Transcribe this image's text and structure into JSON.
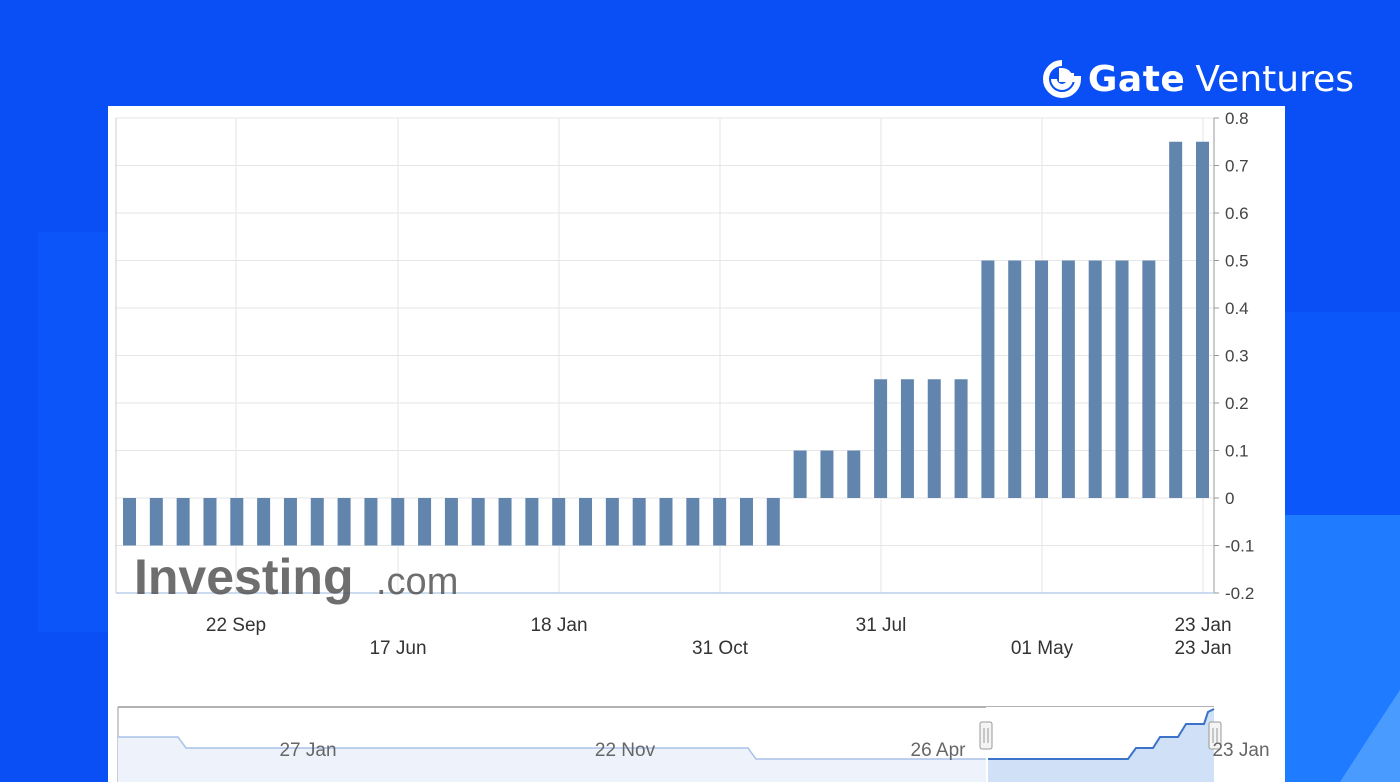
{
  "brand": {
    "name_bold": "Gate",
    "name_light": "Ventures",
    "logo_icon": "gate-g-logo-icon"
  },
  "watermark": {
    "main": "Investing",
    "suffix": ".com"
  },
  "colors": {
    "background": "#0a4ff5",
    "bar": "#6185ad",
    "navigator_line": "#3b73c9",
    "navigator_fill": "#cfe0f7",
    "grid": "#e6e6e6"
  },
  "chart_data": {
    "type": "bar",
    "ylim": [
      -0.2,
      0.8
    ],
    "y_ticks": [
      0.8,
      0.7,
      0.6,
      0.5,
      0.4,
      0.3,
      0.2,
      0.1,
      0,
      -0.1,
      -0.2
    ],
    "y_tick_labels": [
      "0.8",
      "0.7",
      "0.6",
      "0.5",
      "0.4",
      "0.3",
      "0.2",
      "0.1",
      "0",
      "-0.1",
      "-0.2"
    ],
    "grid": true,
    "y_axis_position": "right",
    "values": [
      -0.1,
      -0.1,
      -0.1,
      -0.1,
      -0.1,
      -0.1,
      -0.1,
      -0.1,
      -0.1,
      -0.1,
      -0.1,
      -0.1,
      -0.1,
      -0.1,
      -0.1,
      -0.1,
      -0.1,
      -0.1,
      -0.1,
      -0.1,
      -0.1,
      -0.1,
      -0.1,
      -0.1,
      -0.1,
      0.1,
      0.1,
      0.1,
      0.25,
      0.25,
      0.25,
      0.25,
      0.5,
      0.5,
      0.5,
      0.5,
      0.5,
      0.5,
      0.5,
      0.75,
      0.75
    ],
    "x_tick_labels_row1": [
      "22 Sep",
      "18 Jan",
      "31 Jul",
      "23 Jan"
    ],
    "x_tick_labels_row2": [
      "17 Jun",
      "31 Oct",
      "01 May",
      "23 Jan"
    ],
    "navigator_labels": [
      "27 Jan",
      "22 Nov",
      "26 Apr",
      "23 Jan"
    ]
  }
}
